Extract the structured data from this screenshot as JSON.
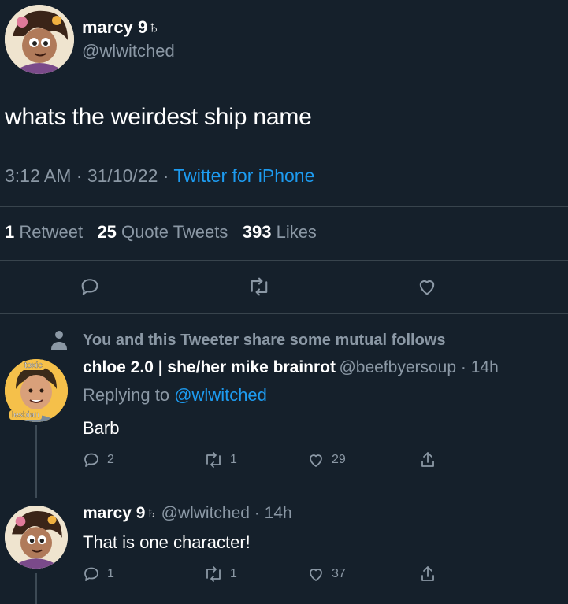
{
  "main_tweet": {
    "display_name": "marcy 9♄",
    "handle": "@wlwitched",
    "text": "whats the weirdest ship name",
    "time": "3:12 AM",
    "date": "31/10/22",
    "source": "Twitter for iPhone",
    "stats": {
      "retweets_count": "1",
      "retweets_label": "Retweet",
      "quotes_count": "25",
      "quotes_label": "Quote Tweets",
      "likes_count": "393",
      "likes_label": "Likes"
    },
    "actions": [
      "reply-icon",
      "retweet-icon",
      "like-icon"
    ]
  },
  "reply1": {
    "mutual_notice": "You and this Tweeter share some mutual follows",
    "display_name": "chloe 2.0 | she/her mike brainrot",
    "handle": "@beefbyersoup",
    "time": "14h",
    "replying_prefix": "Replying to",
    "replying_to": "@wlwitched",
    "text": "Barb",
    "avatar_top_label": "toxic",
    "avatar_bottom_label": "lesbian",
    "reply_count": "2",
    "retweet_count": "1",
    "like_count": "29"
  },
  "reply2": {
    "display_name": "marcy 9♄",
    "handle": "@wlwitched",
    "time": "14h",
    "text": "That is one character!",
    "reply_count": "1",
    "retweet_count": "1",
    "like_count": "37"
  },
  "colors": {
    "background": "#15202b",
    "accent": "#1d9bf0",
    "muted": "#8b98a5",
    "divider": "#38444d"
  }
}
